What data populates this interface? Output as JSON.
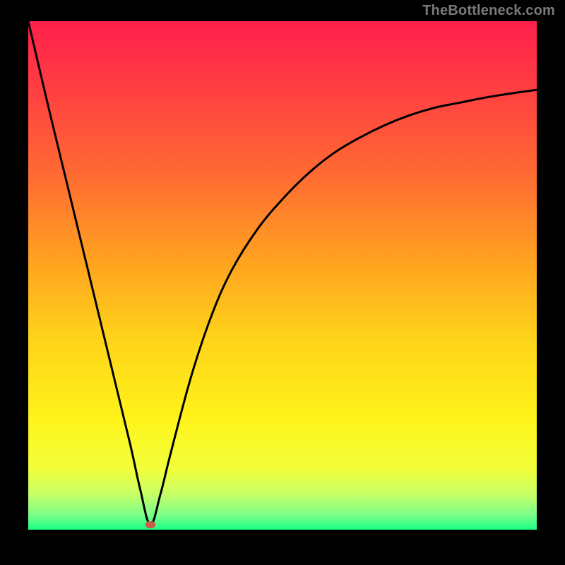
{
  "attribution": "TheBottleneck.com",
  "colors": {
    "background": "#000000",
    "curve": "#000000",
    "marker": "#c85a4a",
    "gradient_stops": [
      {
        "pct": 0,
        "hex": "#ff1f4b"
      },
      {
        "pct": 12,
        "hex": "#ff3b43"
      },
      {
        "pct": 30,
        "hex": "#ff6a33"
      },
      {
        "pct": 48,
        "hex": "#ffa51f"
      },
      {
        "pct": 62,
        "hex": "#ffd21a"
      },
      {
        "pct": 78,
        "hex": "#fff31a"
      },
      {
        "pct": 88,
        "hex": "#f2ff3a"
      },
      {
        "pct": 93,
        "hex": "#c8ff66"
      },
      {
        "pct": 97,
        "hex": "#7dff88"
      },
      {
        "pct": 100,
        "hex": "#1aff85"
      }
    ]
  },
  "chart_data": {
    "type": "line",
    "title": "",
    "xlabel": "",
    "ylabel": "",
    "xlim": [
      0,
      100
    ],
    "ylim": [
      0,
      100
    ],
    "optimum_x": 24,
    "x": [
      0,
      4,
      8,
      12,
      16,
      20,
      22,
      24,
      26,
      28,
      32,
      36,
      40,
      45,
      50,
      55,
      60,
      65,
      70,
      75,
      80,
      85,
      90,
      95,
      100
    ],
    "values": [
      100,
      83,
      66.5,
      50,
      33.5,
      17,
      8,
      1,
      7,
      15,
      30,
      42,
      51,
      59,
      65,
      70,
      74,
      77,
      79.5,
      81.5,
      83,
      84,
      85,
      85.8,
      86.5
    ]
  }
}
